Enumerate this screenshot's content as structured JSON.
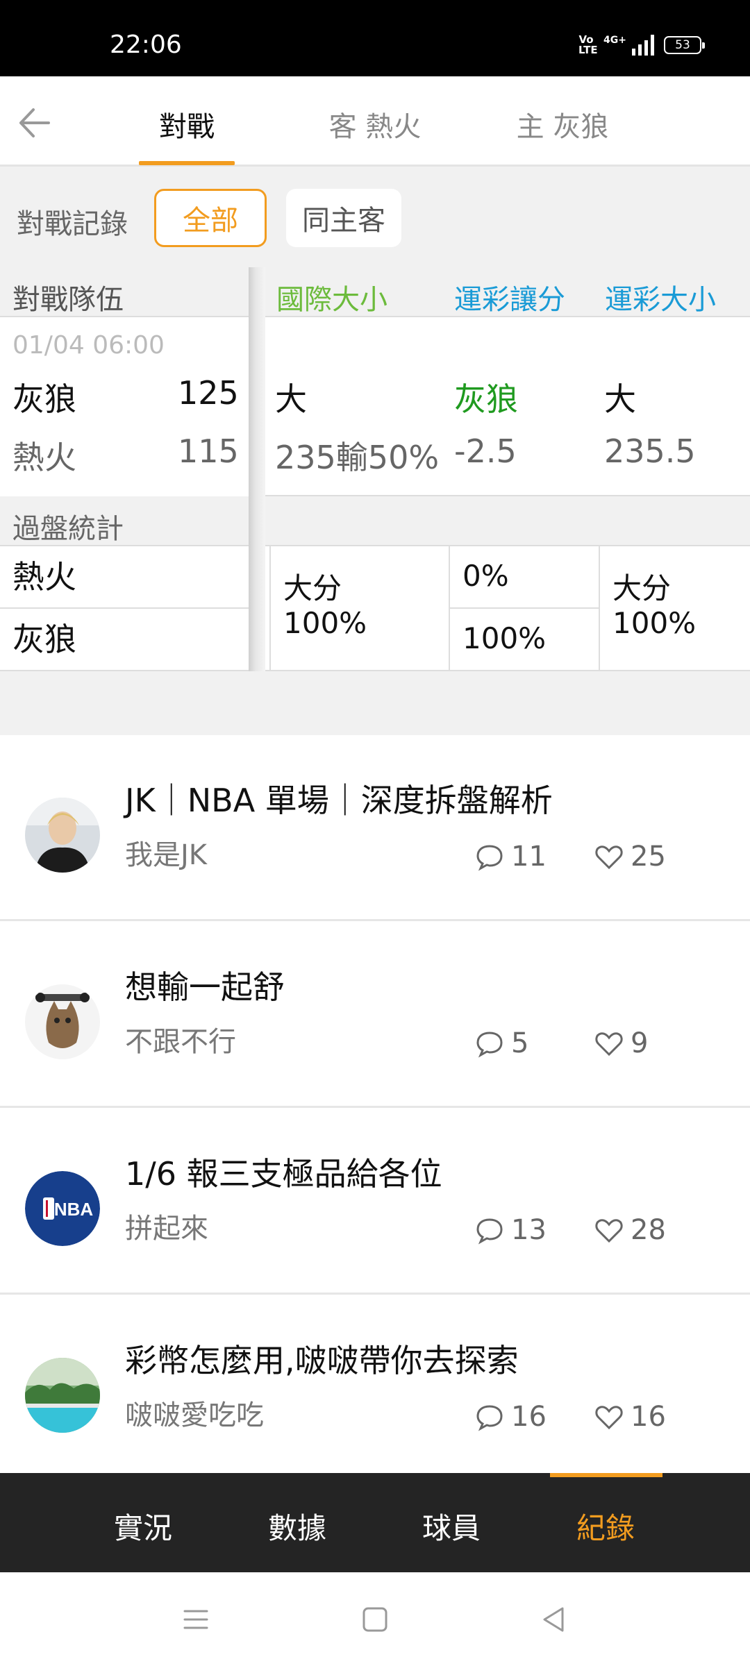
{
  "status_bar": {
    "time": "22:06",
    "network": "4G+",
    "volte": "Vo LTE",
    "battery": "53"
  },
  "top_tabs": [
    "對戰",
    "客 熱火",
    "主 灰狼"
  ],
  "filter": {
    "label": "對戰記錄",
    "options": [
      "全部",
      "同主客"
    ],
    "selected": "全部"
  },
  "table": {
    "headers": [
      "對戰隊伍",
      "國際大小",
      "運彩讓分",
      "運彩大小"
    ],
    "match": {
      "date": "01/04 06:00",
      "home": {
        "team": "灰狼",
        "score": "125"
      },
      "away": {
        "team": "熱火",
        "score": "115"
      },
      "intl_result": "大",
      "intl_line": "235輸50%",
      "spread_result": "灰狼",
      "spread_line": "-2.5",
      "total_result": "大",
      "total_line": "235.5"
    },
    "stats": {
      "label": "過盤統計",
      "teams": [
        "熱火",
        "灰狼"
      ],
      "intl": "大分\n100%",
      "spread_top": "0%",
      "spread_bottom": "100%",
      "total": "大分\n100%"
    }
  },
  "posts": [
    {
      "title": "JK｜NBA 單場｜深度拆盤解析",
      "author": "我是JK",
      "comments": "11",
      "likes": "25",
      "avatar": "person-avatar"
    },
    {
      "title": "想輸一起舒",
      "author": "不跟不行",
      "comments": "5",
      "likes": "9",
      "avatar": "cat-avatar"
    },
    {
      "title": "1/6 報三支極品給各位",
      "author": "拼起來",
      "comments": "13",
      "likes": "28",
      "avatar": "nba-logo-avatar",
      "logo_text": "NBA"
    },
    {
      "title": "彩幣怎麼用,啵啵帶你去探索",
      "author": "啵啵愛吃吃",
      "comments": "16",
      "likes": "16",
      "avatar": "pool-avatar"
    }
  ],
  "bottom_nav": [
    "實況",
    "數據",
    "球員",
    "紀錄"
  ],
  "bottom_nav_active": "紀錄",
  "colors": {
    "accent": "#f29c1f",
    "green": "#1f9a1f",
    "header_green": "#6cbb3c",
    "header_blue": "#1a9bd6",
    "nav_bg": "#242424"
  }
}
